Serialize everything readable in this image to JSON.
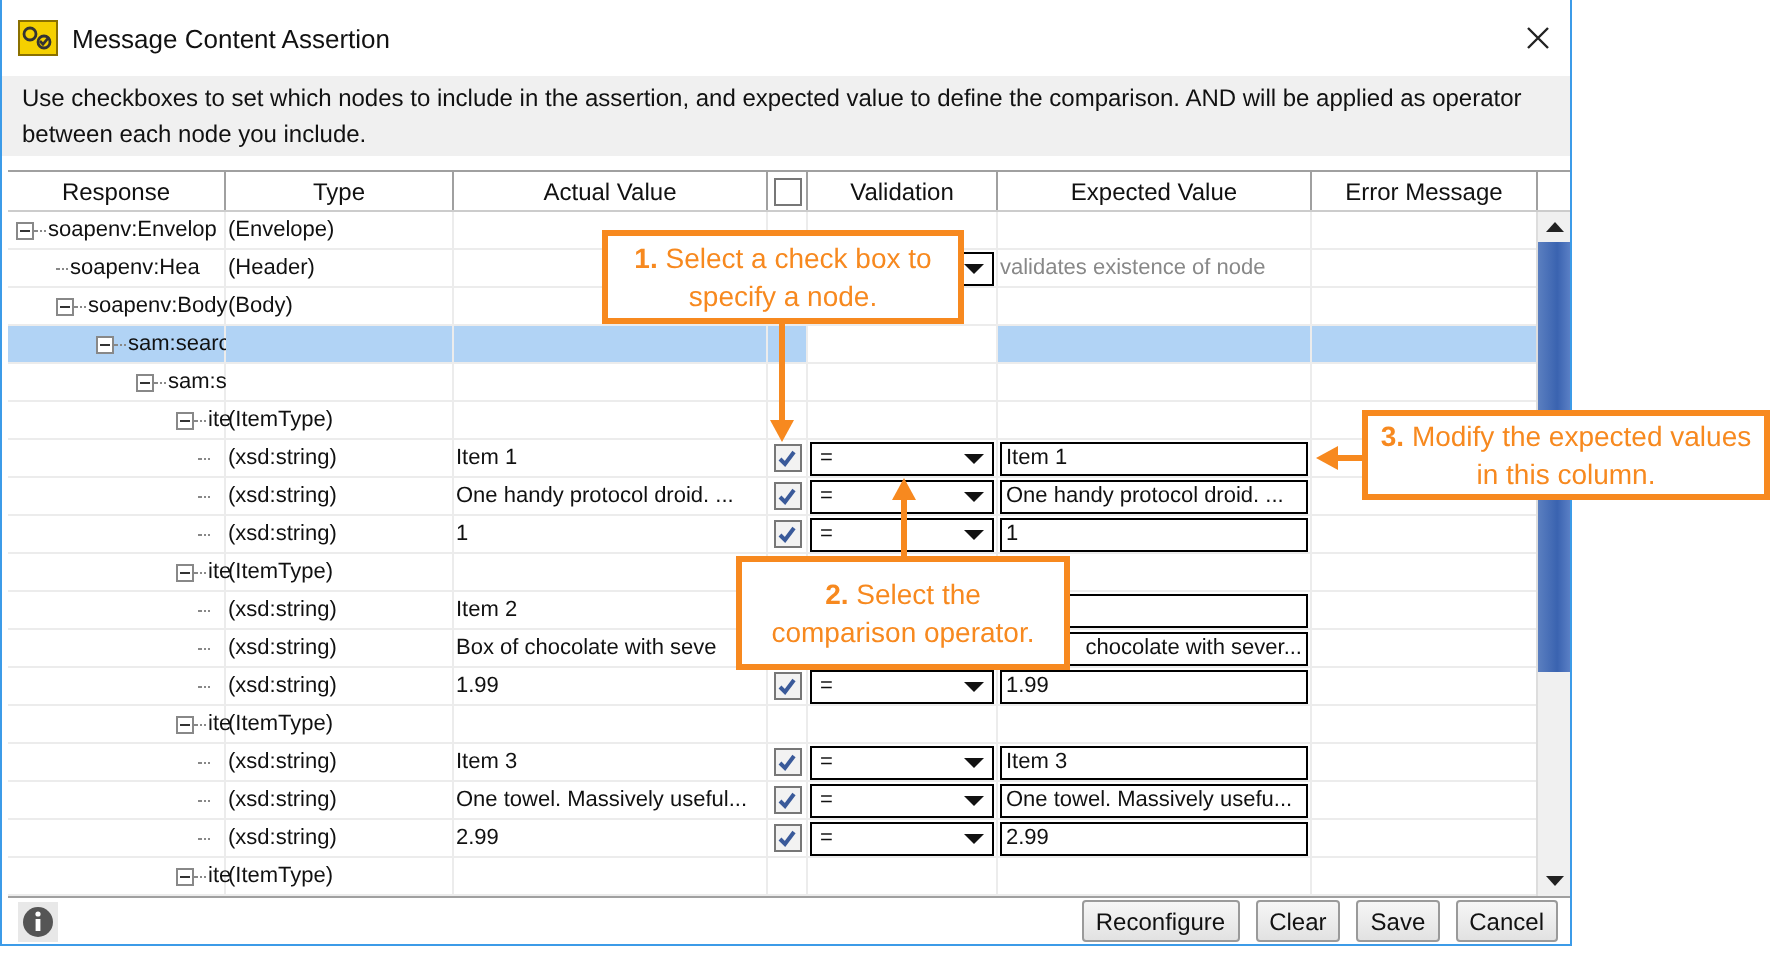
{
  "window": {
    "title": "Message Content Assertion"
  },
  "description": "Use checkboxes to set which nodes to include in the assertion, and expected value to define the comparison. AND will be applied as operator between each node you include.",
  "table": {
    "columns": [
      "Response",
      "Type",
      "Actual Value",
      "Validation",
      "Expected Value",
      "Error Message"
    ],
    "header_checkbox": {
      "checked": false
    },
    "rows": [
      {
        "response": "soapenv:Envelop",
        "type": "(Envelope)",
        "selected": false,
        "expanded": true,
        "children": [
          {
            "response": "soapenv:Hea",
            "type": "(Header)",
            "selected": false,
            "kind": "node_check",
            "expected_value": "validates existence of node"
          },
          {
            "response": "soapenv:Body",
            "type": "(Body)",
            "selected": false,
            "expanded": true,
            "children": [
              {
                "response": "sam:searc",
                "selected": true,
                "expanded": true,
                "children": [
                  {
                    "response": "sam:s",
                    "selected": false,
                    "expanded": true,
                    "children": [
                      {
                        "response": "ite",
                        "type": "(ItemType)",
                        "selected": false,
                        "expanded": true,
                        "children": [
                          {
                            "type": "(xsd:string)",
                            "actual_value": "Item 1",
                            "kind": "value_check",
                            "checked": true,
                            "validation": "=",
                            "expected_value": "Item 1",
                            "selected": false
                          },
                          {
                            "type": "(xsd:string)",
                            "actual_value": "One handy protocol droid. ...",
                            "kind": "value_check",
                            "checked": true,
                            "validation": "=",
                            "expected_value": "One handy protocol droid. ...",
                            "selected": false
                          },
                          {
                            "type": "(xsd:string)",
                            "actual_value": "1",
                            "kind": "value_check",
                            "checked": true,
                            "validation": "=",
                            "expected_value": "1",
                            "selected": false
                          }
                        ]
                      },
                      {
                        "response": "ite",
                        "type": "(ItemType)",
                        "selected": false,
                        "expanded": true,
                        "children": [
                          {
                            "type": "(xsd:string)",
                            "actual_value": "Item 2",
                            "kind": "value_check",
                            "selected": false
                          },
                          {
                            "type": "(xsd:string)",
                            "actual_value": "Box of chocolate with seve",
                            "kind": "value_check",
                            "expected_value": "chocolate with sever...",
                            "selected": false
                          },
                          {
                            "type": "(xsd:string)",
                            "actual_value": "1.99",
                            "kind": "value_check",
                            "checked": true,
                            "validation": "=",
                            "expected_value": "1.99",
                            "selected": false
                          }
                        ]
                      },
                      {
                        "response": "ite",
                        "type": "(ItemType)",
                        "selected": false,
                        "expanded": true,
                        "children": [
                          {
                            "type": "(xsd:string)",
                            "actual_value": "Item 3",
                            "kind": "value_check",
                            "checked": true,
                            "validation": "=",
                            "expected_value": "Item 3",
                            "selected": false
                          },
                          {
                            "type": "(xsd:string)",
                            "actual_value": "One towel. Massively useful...",
                            "kind": "value_check",
                            "checked": true,
                            "validation": "=",
                            "expected_value": "One towel. Massively usefu...",
                            "selected": false
                          },
                          {
                            "type": "(xsd:string)",
                            "actual_value": "2.99",
                            "kind": "value_check",
                            "checked": true,
                            "validation": "=",
                            "expected_value": "2.99",
                            "selected": false
                          }
                        ]
                      },
                      {
                        "response": "ite",
                        "type": "(ItemType)",
                        "selected": false,
                        "expanded": true
                      }
                    ]
                  }
                ]
              }
            ]
          }
        ]
      }
    ]
  },
  "buttons": [
    "Reconfigure",
    "Clear",
    "Save",
    "Cancel"
  ],
  "callouts": [
    {
      "text": "**1.** Select a check box to specify a node."
    },
    {
      "text": "**2.** Select the comparison operator."
    },
    {
      "text": "**3.** Modify the expected values in this column."
    }
  ]
}
